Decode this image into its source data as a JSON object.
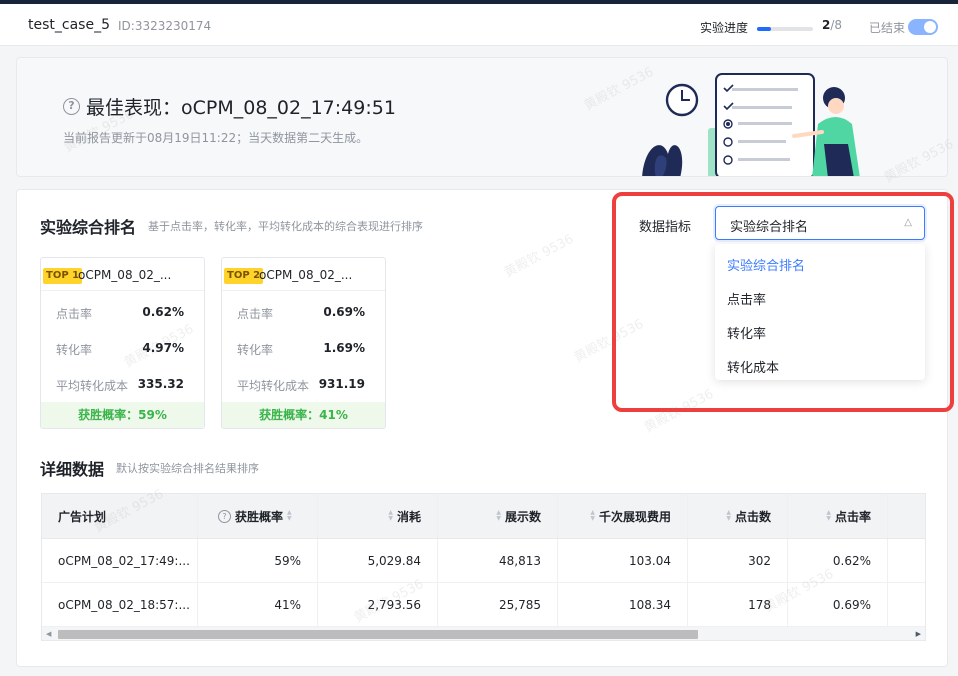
{
  "header": {
    "title": "test_case_5",
    "id_text": "ID:3323230174",
    "progress_label": "实验进度",
    "progress_current": "2",
    "progress_total": "/8",
    "progress_fraction": 0.25,
    "ended_label": "已结束",
    "ended_toggle_on": true
  },
  "best": {
    "title": "最佳表现：oCPM_08_02_17:49:51",
    "subtitle": "当前报告更新于08月19日11:22；当天数据第二天生成。"
  },
  "ranking": {
    "title": "实验综合排名",
    "description": "基于点击率，转化率，平均转化成本的综合表现进行排序",
    "cards": [
      {
        "badge": "TOP 1",
        "name": "oCPM_08_02_...",
        "metrics": [
          {
            "label": "点击率",
            "value": "0.62%"
          },
          {
            "label": "转化率",
            "value": "4.97%"
          },
          {
            "label": "平均转化成本",
            "value": "335.32"
          }
        ],
        "win_rate": "获胜概率：59%"
      },
      {
        "badge": "TOP 2",
        "name": "oCPM_08_02_...",
        "metrics": [
          {
            "label": "点击率",
            "value": "0.69%"
          },
          {
            "label": "转化率",
            "value": "1.69%"
          },
          {
            "label": "平均转化成本",
            "value": "931.19"
          }
        ],
        "win_rate": "获胜概率：41%"
      }
    ]
  },
  "filter": {
    "label": "数据指标",
    "selected": "实验综合排名",
    "options": [
      "实验综合排名",
      "点击率",
      "转化率",
      "转化成本"
    ]
  },
  "detail": {
    "title": "详细数据",
    "description": "默认按实验综合排名结果排序",
    "columns": [
      "广告计划",
      "获胜概率",
      "消耗",
      "展示数",
      "千次展现费用",
      "点击数",
      "点击率"
    ],
    "rows": [
      [
        "oCPM_08_02_17:49:...",
        "59%",
        "5,029.84",
        "48,813",
        "103.04",
        "302",
        "0.62%"
      ],
      [
        "oCPM_08_02_18:57:...",
        "41%",
        "2,793.56",
        "25,785",
        "108.34",
        "178",
        "0.69%"
      ]
    ]
  },
  "watermark_text": "黄殿钦 9536",
  "colors": {
    "accent": "#3c7bff",
    "highlight_border": "#ee3f3f",
    "win_green": "#3bb44a",
    "badge_yellow": "#ffd32a"
  }
}
